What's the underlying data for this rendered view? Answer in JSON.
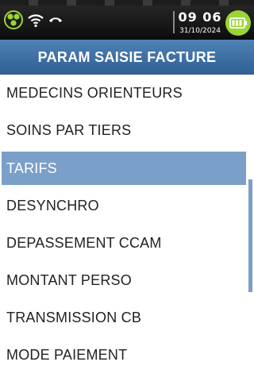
{
  "status_bar": {
    "time": "09 06",
    "date": "31/10/2024",
    "icons": [
      "network-icon",
      "wifi-icon",
      "phone-icon",
      "battery-icon"
    ],
    "battery_color": "#9bd434"
  },
  "header": {
    "title": "PARAM SAISIE FACTURE",
    "color": "#3d6fa4"
  },
  "menu": {
    "selected_index": 2,
    "selected_color": "#7a9fc9",
    "items": [
      {
        "label": "MEDECINS ORIENTEURS"
      },
      {
        "label": "SOINS PAR TIERS"
      },
      {
        "label": "TARIFS"
      },
      {
        "label": "DESYNCHRO"
      },
      {
        "label": "DEPASSEMENT CCAM"
      },
      {
        "label": "MONTANT PERSO"
      },
      {
        "label": "TRANSMISSION CB"
      },
      {
        "label": "MODE PAIEMENT"
      }
    ]
  }
}
